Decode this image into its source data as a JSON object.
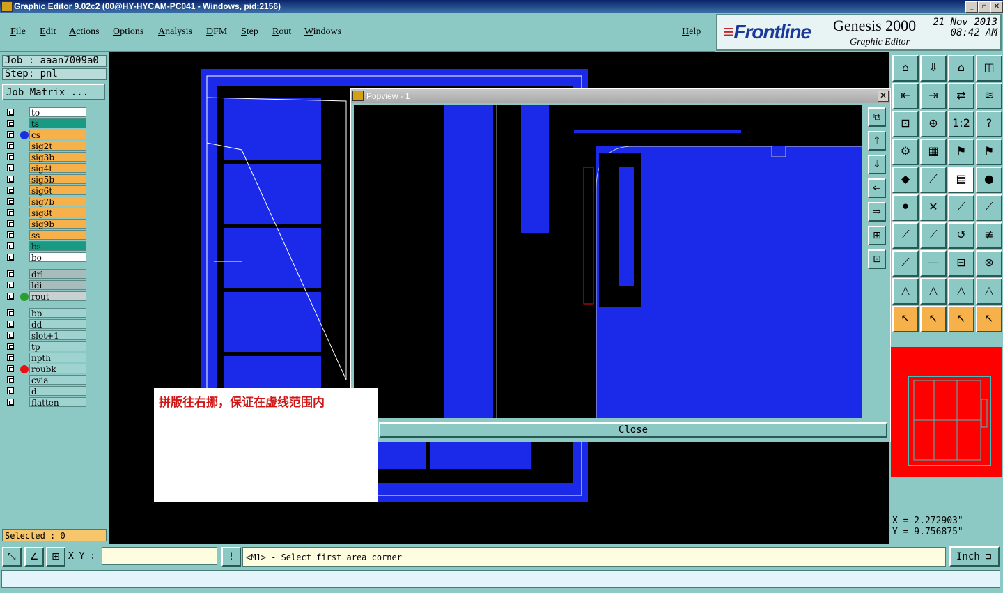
{
  "window": {
    "title": "Graphic Editor 9.02c2 (00@HY-HYCAM-PC041 - Windows, pid:2156)",
    "min": "_",
    "max": "▫",
    "close": "✕"
  },
  "menu": [
    "File",
    "Edit",
    "Actions",
    "Options",
    "Analysis",
    "DFM",
    "Step",
    "Rout",
    "Windows"
  ],
  "help_label": "Help",
  "brand": {
    "logo_prefix": "≡",
    "logo": "Frontline",
    "product": "Genesis 2000",
    "subtitle": "Graphic Editor",
    "date": "21 Nov 2013",
    "time": "08:42 AM"
  },
  "job": {
    "job_line": "Job : aaan7009a0",
    "step_line": "Step: pnl",
    "matrix_label": "Job Matrix ..."
  },
  "layers": [
    {
      "name": "to",
      "color": "#ffffff",
      "dot": ""
    },
    {
      "name": "ts",
      "color": "#199a82",
      "dot": ""
    },
    {
      "name": "cs",
      "color": "#f6b14a",
      "dot": "#1a30d8"
    },
    {
      "name": "sig2t",
      "color": "#f6b14a",
      "dot": ""
    },
    {
      "name": "sig3b",
      "color": "#f6b14a",
      "dot": ""
    },
    {
      "name": "sig4t",
      "color": "#f6b14a",
      "dot": ""
    },
    {
      "name": "sig5b",
      "color": "#f6b14a",
      "dot": ""
    },
    {
      "name": "sig6t",
      "color": "#f6b14a",
      "dot": ""
    },
    {
      "name": "sig7b",
      "color": "#f6b14a",
      "dot": ""
    },
    {
      "name": "sig8t",
      "color": "#f6b14a",
      "dot": ""
    },
    {
      "name": "sig9b",
      "color": "#f6b14a",
      "dot": ""
    },
    {
      "name": "ss",
      "color": "#f6b14a",
      "dot": ""
    },
    {
      "name": "bs",
      "color": "#199a82",
      "dot": ""
    },
    {
      "name": "bo",
      "color": "#ffffff",
      "dot": ""
    },
    {
      "name": "drl",
      "color": "#a7bcbd",
      "dot": ""
    },
    {
      "name": "ldi",
      "color": "#a7bcbd",
      "dot": ""
    },
    {
      "name": "rout",
      "color": "#c8d0d0",
      "dot": "#2aa02a"
    },
    {
      "name": "bp",
      "color": "#9fd3cf",
      "dot": ""
    },
    {
      "name": "dd",
      "color": "#9fd3cf",
      "dot": ""
    },
    {
      "name": "slot+1",
      "color": "#9fd3cf",
      "dot": ""
    },
    {
      "name": "tp",
      "color": "#9fd3cf",
      "dot": ""
    },
    {
      "name": "npth",
      "color": "#9fd3cf",
      "dot": ""
    },
    {
      "name": "roubk",
      "color": "#9fd3cf",
      "dot": "#e81010"
    },
    {
      "name": "cvia",
      "color": "#9fd3cf",
      "dot": ""
    },
    {
      "name": "d",
      "color": "#9fd3cf",
      "dot": ""
    },
    {
      "name": "flatten",
      "color": "#9fd3cf",
      "dot": ""
    }
  ],
  "selected_label": "Selected : 0",
  "popview": {
    "title": "Popview - 1",
    "close_label": "Close",
    "close_x": "✕"
  },
  "note_text": "拼版往右挪，保证在虚线范围内",
  "coords": {
    "x_line": "X = 2.272903\"",
    "y_line": "Y = 9.756875\""
  },
  "bottom": {
    "xy_label": "X Y :",
    "xy_value": "",
    "exclaim": "!",
    "status": "<M1> - Select first area corner",
    "unit": "Inch ⊐"
  }
}
